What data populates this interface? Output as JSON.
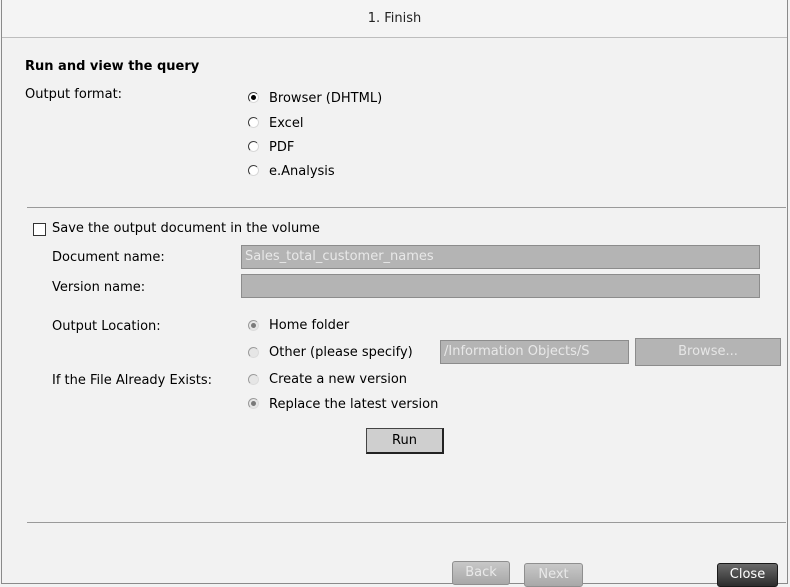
{
  "title": "1. Finish",
  "section_heading": "Run and view the query",
  "output_format": {
    "label": "Output format:",
    "options": [
      {
        "label": "Browser (DHTML)",
        "selected": true
      },
      {
        "label": "Excel",
        "selected": false
      },
      {
        "label": "PDF",
        "selected": false
      },
      {
        "label": "e.Analysis",
        "selected": false
      }
    ]
  },
  "save": {
    "checkbox_label": "Save the output document in the volume",
    "checked": false,
    "document_name_label": "Document name:",
    "document_name_value": "Sales_total_customer_names",
    "version_name_label": "Version name:",
    "version_name_value": "",
    "output_location_label": "Output Location:",
    "location_options": [
      {
        "label": "Home folder",
        "selected": true
      },
      {
        "label": "Other (please specify)",
        "selected": false
      }
    ],
    "other_path_value": "/Information Objects/S",
    "browse_label": "Browse...",
    "exists_label": "If the File Already Exists:",
    "exists_options": [
      {
        "label": "Create a new version",
        "selected": false
      },
      {
        "label": "Replace the latest version",
        "selected": true
      }
    ]
  },
  "run_label": "Run",
  "footer": {
    "back_label": "Back",
    "next_label": "Next",
    "close_label": "Close"
  }
}
